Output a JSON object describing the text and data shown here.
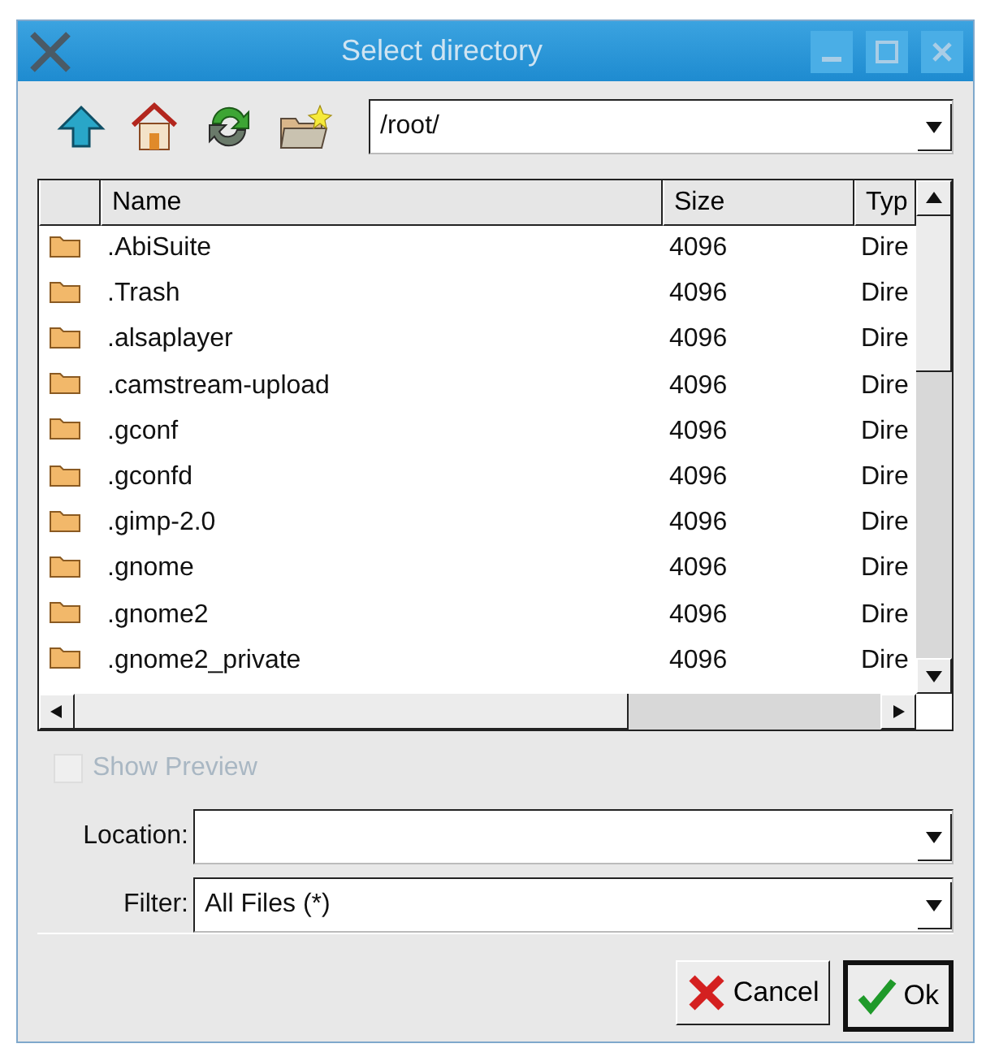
{
  "window": {
    "title": "Select directory"
  },
  "toolbar": {
    "path": "/root/"
  },
  "table": {
    "columns": [
      "Name",
      "Size",
      "Typ"
    ],
    "rows": [
      {
        "name": ".AbiSuite",
        "size": "4096",
        "type": "Dire"
      },
      {
        "name": ".Trash",
        "size": "4096",
        "type": "Dire"
      },
      {
        "name": ".alsaplayer",
        "size": "4096",
        "type": "Dire"
      },
      {
        "name": ".camstream-upload",
        "size": "4096",
        "type": "Dire"
      },
      {
        "name": ".gconf",
        "size": "4096",
        "type": "Dire"
      },
      {
        "name": ".gconfd",
        "size": "4096",
        "type": "Dire"
      },
      {
        "name": ".gimp-2.0",
        "size": "4096",
        "type": "Dire"
      },
      {
        "name": ".gnome",
        "size": "4096",
        "type": "Dire"
      },
      {
        "name": ".gnome2",
        "size": "4096",
        "type": "Dire"
      },
      {
        "name": ".gnome2_private",
        "size": "4096",
        "type": "Dire"
      }
    ]
  },
  "show_preview": {
    "label": "Show Preview",
    "checked": false,
    "disabled": true
  },
  "location": {
    "label": "Location:"
  },
  "filter": {
    "label": "Filter:",
    "value": "All Files (*)"
  },
  "buttons": [
    {
      "kind": "cancel",
      "label": "Cancel",
      "default": false
    },
    {
      "kind": "ok",
      "label": "Ok",
      "default": true
    }
  ]
}
